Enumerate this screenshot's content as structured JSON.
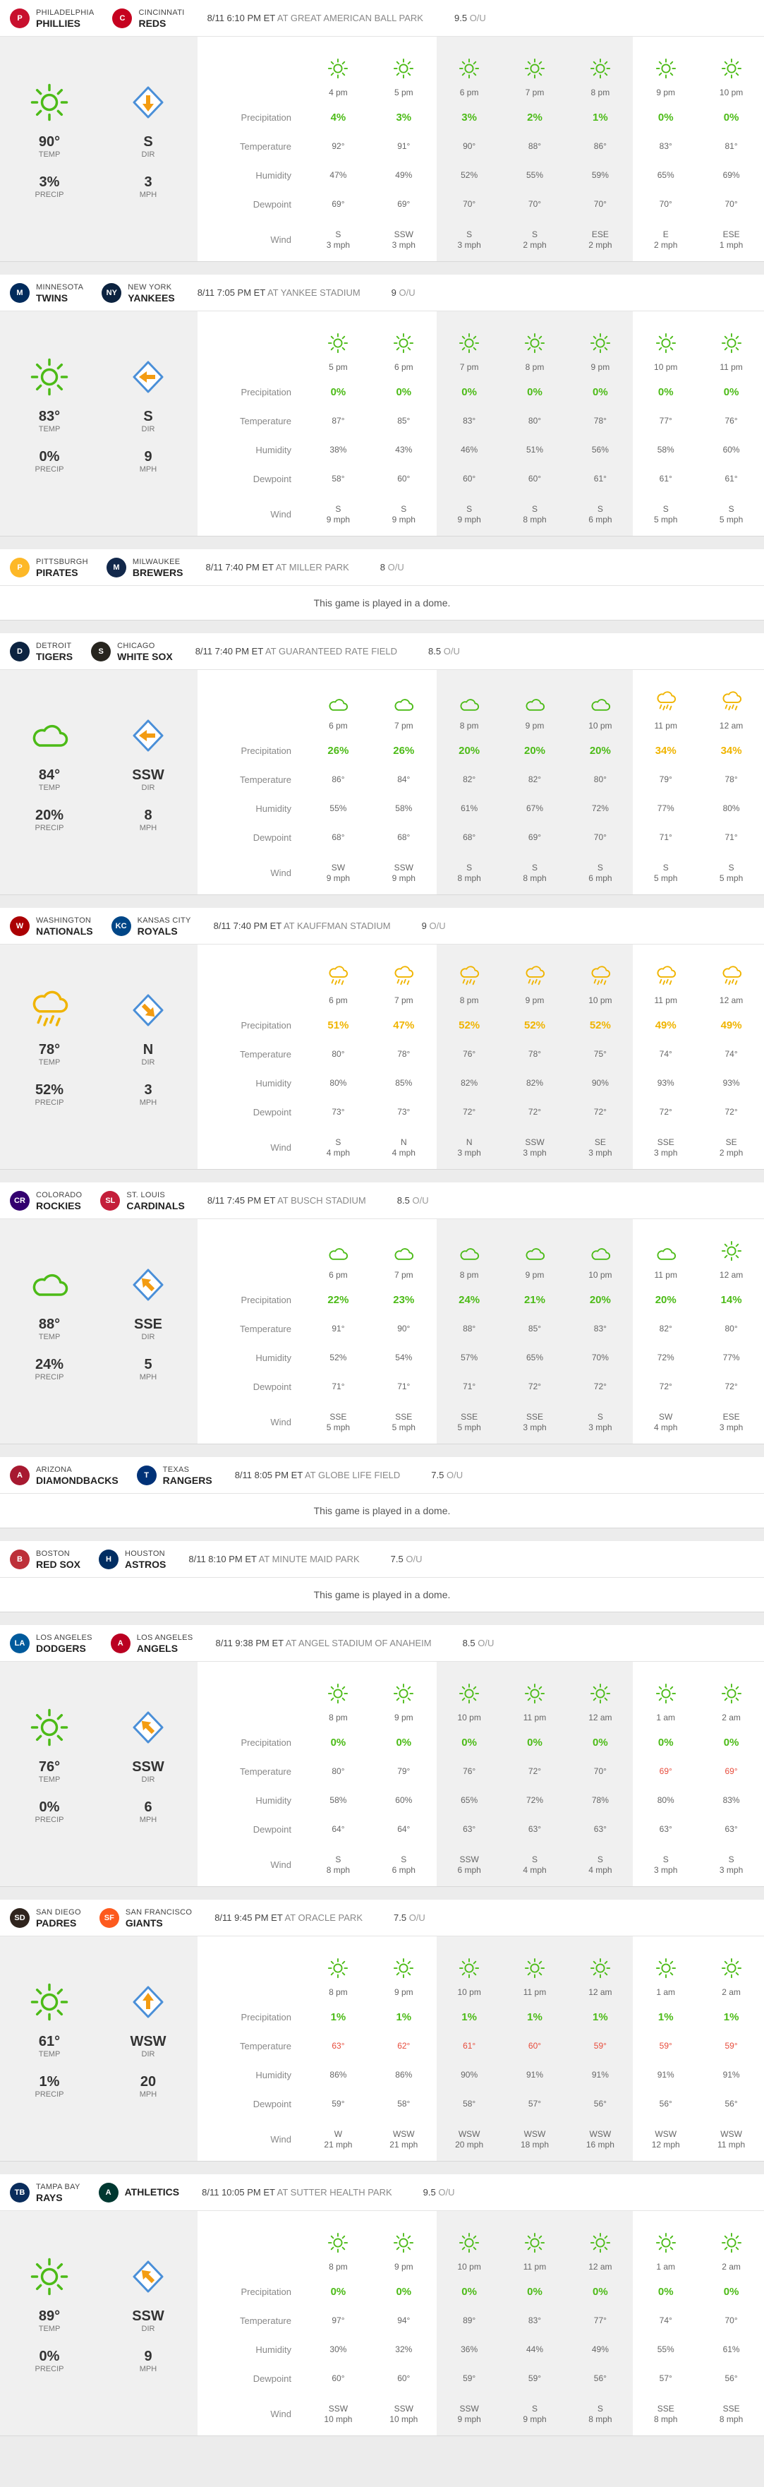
{
  "labels": {
    "precipitation": "Precipitation",
    "temperature": "Temperature",
    "humidity": "Humidity",
    "dewpoint": "Dewpoint",
    "wind": "Wind",
    "temp": "TEMP",
    "precip": "PRECIP",
    "dir": "DIR",
    "mph": "MPH",
    "ou": "O/U"
  },
  "colors": {
    "green": "#4cbb17",
    "yellow": "#f0b400",
    "red": "#e74c3c"
  },
  "games": [
    {
      "away": {
        "city": "Philadelphia",
        "nick": "Phillies",
        "abbr": "P",
        "color": "#c8102e"
      },
      "home": {
        "city": "Cincinnati",
        "nick": "Reds",
        "abbr": "C",
        "color": "#c6011f"
      },
      "time": "8/11 6:10 PM ET",
      "park": "at Great American Ball Park",
      "ou": "9.5",
      "dome": false,
      "summary": {
        "icon": "sun",
        "temp": "90°",
        "precip": "3%",
        "dir": "S",
        "mph": "3",
        "arrow": "S"
      },
      "hours": [
        {
          "t": "4 pm",
          "icon": "sun",
          "p": "4%",
          "temp": "92°",
          "hum": "47%",
          "dew": "69°",
          "wd": "S",
          "ws": "3 mph"
        },
        {
          "t": "5 pm",
          "icon": "sun",
          "p": "3%",
          "temp": "91°",
          "hum": "49%",
          "dew": "69°",
          "wd": "SSW",
          "ws": "3 mph"
        },
        {
          "t": "6 pm",
          "icon": "sun",
          "p": "3%",
          "temp": "90°",
          "hum": "52%",
          "dew": "70°",
          "wd": "S",
          "ws": "3 mph"
        },
        {
          "t": "7 pm",
          "icon": "sun",
          "p": "2%",
          "temp": "88°",
          "hum": "55%",
          "dew": "70°",
          "wd": "S",
          "ws": "2 mph"
        },
        {
          "t": "8 pm",
          "icon": "sun",
          "p": "1%",
          "temp": "86°",
          "hum": "59%",
          "dew": "70°",
          "wd": "ESE",
          "ws": "2 mph"
        },
        {
          "t": "9 pm",
          "icon": "sun",
          "p": "0%",
          "temp": "83°",
          "hum": "65%",
          "dew": "70°",
          "wd": "E",
          "ws": "2 mph"
        },
        {
          "t": "10 pm",
          "icon": "sun",
          "p": "0%",
          "temp": "81°",
          "hum": "69%",
          "dew": "70°",
          "wd": "ESE",
          "ws": "1 mph"
        }
      ]
    },
    {
      "away": {
        "city": "Minnesota",
        "nick": "Twins",
        "abbr": "M",
        "color": "#002b5c"
      },
      "home": {
        "city": "New York",
        "nick": "Yankees",
        "abbr": "NY",
        "color": "#0c2340"
      },
      "time": "8/11 7:05 PM ET",
      "park": "at Yankee Stadium",
      "ou": "9",
      "dome": false,
      "summary": {
        "icon": "sun",
        "temp": "83°",
        "precip": "0%",
        "dir": "S",
        "mph": "9",
        "arrow": "W"
      },
      "hours": [
        {
          "t": "5 pm",
          "icon": "sun",
          "p": "0%",
          "temp": "87°",
          "hum": "38%",
          "dew": "58°",
          "wd": "S",
          "ws": "9 mph"
        },
        {
          "t": "6 pm",
          "icon": "sun",
          "p": "0%",
          "temp": "85°",
          "hum": "43%",
          "dew": "60°",
          "wd": "S",
          "ws": "9 mph"
        },
        {
          "t": "7 pm",
          "icon": "sun",
          "p": "0%",
          "temp": "83°",
          "hum": "46%",
          "dew": "60°",
          "wd": "S",
          "ws": "9 mph"
        },
        {
          "t": "8 pm",
          "icon": "sun",
          "p": "0%",
          "temp": "80°",
          "hum": "51%",
          "dew": "60°",
          "wd": "S",
          "ws": "8 mph"
        },
        {
          "t": "9 pm",
          "icon": "sun",
          "p": "0%",
          "temp": "78°",
          "hum": "56%",
          "dew": "61°",
          "wd": "S",
          "ws": "6 mph"
        },
        {
          "t": "10 pm",
          "icon": "sun",
          "p": "0%",
          "temp": "77°",
          "hum": "58%",
          "dew": "61°",
          "wd": "S",
          "ws": "5 mph"
        },
        {
          "t": "11 pm",
          "icon": "sun",
          "p": "0%",
          "temp": "76°",
          "hum": "60%",
          "dew": "61°",
          "wd": "S",
          "ws": "5 mph"
        }
      ]
    },
    {
      "away": {
        "city": "Pittsburgh",
        "nick": "Pirates",
        "abbr": "P",
        "color": "#fdb827"
      },
      "home": {
        "city": "Milwaukee",
        "nick": "Brewers",
        "abbr": "M",
        "color": "#12284b"
      },
      "time": "8/11 7:40 PM ET",
      "park": "at Miller Park",
      "ou": "8",
      "dome": true,
      "domeText": "This game is played in a dome."
    },
    {
      "away": {
        "city": "Detroit",
        "nick": "Tigers",
        "abbr": "D",
        "color": "#0c2340"
      },
      "home": {
        "city": "Chicago",
        "nick": "White Sox",
        "abbr": "S",
        "color": "#27251f"
      },
      "time": "8/11 7:40 PM ET",
      "park": "at Guaranteed Rate Field",
      "ou": "8.5",
      "dome": false,
      "summary": {
        "icon": "cloud",
        "temp": "84°",
        "precip": "20%",
        "dir": "SSW",
        "mph": "8",
        "arrow": "W"
      },
      "hours": [
        {
          "t": "6 pm",
          "icon": "cloud",
          "p": "26%",
          "temp": "86°",
          "hum": "55%",
          "dew": "68°",
          "wd": "SW",
          "ws": "9 mph"
        },
        {
          "t": "7 pm",
          "icon": "cloud",
          "p": "26%",
          "temp": "84°",
          "hum": "58%",
          "dew": "68°",
          "wd": "SSW",
          "ws": "9 mph"
        },
        {
          "t": "8 pm",
          "icon": "cloud",
          "p": "20%",
          "temp": "82°",
          "hum": "61%",
          "dew": "68°",
          "wd": "S",
          "ws": "8 mph"
        },
        {
          "t": "9 pm",
          "icon": "cloud",
          "p": "20%",
          "temp": "82°",
          "hum": "67%",
          "dew": "69°",
          "wd": "S",
          "ws": "8 mph"
        },
        {
          "t": "10 pm",
          "icon": "cloud",
          "p": "20%",
          "temp": "80°",
          "hum": "72%",
          "dew": "70°",
          "wd": "S",
          "ws": "6 mph"
        },
        {
          "t": "11 pm",
          "icon": "rain",
          "p": "34%",
          "y": true,
          "temp": "79°",
          "hum": "77%",
          "dew": "71°",
          "wd": "S",
          "ws": "5 mph"
        },
        {
          "t": "12 am",
          "icon": "rain",
          "p": "34%",
          "y": true,
          "temp": "78°",
          "hum": "80%",
          "dew": "71°",
          "wd": "S",
          "ws": "5 mph"
        }
      ]
    },
    {
      "away": {
        "city": "Washington",
        "nick": "Nationals",
        "abbr": "W",
        "color": "#ab0003"
      },
      "home": {
        "city": "Kansas City",
        "nick": "Royals",
        "abbr": "KC",
        "color": "#004687"
      },
      "time": "8/11 7:40 PM ET",
      "park": "at Kauffman Stadium",
      "ou": "9",
      "dome": false,
      "summary": {
        "icon": "rain",
        "temp": "78°",
        "precip": "52%",
        "dir": "N",
        "mph": "3",
        "arrow": "SE"
      },
      "hours": [
        {
          "t": "6 pm",
          "icon": "rain",
          "p": "51%",
          "y": true,
          "temp": "80°",
          "hum": "80%",
          "dew": "73°",
          "wd": "S",
          "ws": "4 mph"
        },
        {
          "t": "7 pm",
          "icon": "rain",
          "p": "47%",
          "y": true,
          "temp": "78°",
          "hum": "85%",
          "dew": "73°",
          "wd": "N",
          "ws": "4 mph"
        },
        {
          "t": "8 pm",
          "icon": "rain",
          "p": "52%",
          "y": true,
          "temp": "76°",
          "hum": "82%",
          "dew": "72°",
          "wd": "N",
          "ws": "3 mph"
        },
        {
          "t": "9 pm",
          "icon": "rain",
          "p": "52%",
          "y": true,
          "temp": "78°",
          "hum": "82%",
          "dew": "72°",
          "wd": "SSW",
          "ws": "3 mph"
        },
        {
          "t": "10 pm",
          "icon": "rain",
          "p": "52%",
          "y": true,
          "temp": "75°",
          "hum": "90%",
          "dew": "72°",
          "wd": "SE",
          "ws": "3 mph"
        },
        {
          "t": "11 pm",
          "icon": "rain",
          "p": "49%",
          "y": true,
          "temp": "74°",
          "hum": "93%",
          "dew": "72°",
          "wd": "SSE",
          "ws": "3 mph"
        },
        {
          "t": "12 am",
          "icon": "rain",
          "p": "49%",
          "y": true,
          "temp": "74°",
          "hum": "93%",
          "dew": "72°",
          "wd": "SE",
          "ws": "2 mph"
        }
      ]
    },
    {
      "away": {
        "city": "Colorado",
        "nick": "Rockies",
        "abbr": "CR",
        "color": "#33006f"
      },
      "home": {
        "city": "St. Louis",
        "nick": "Cardinals",
        "abbr": "SL",
        "color": "#c41e3a"
      },
      "time": "8/11 7:45 PM ET",
      "park": "at Busch Stadium",
      "ou": "8.5",
      "dome": false,
      "summary": {
        "icon": "cloud",
        "temp": "88°",
        "precip": "24%",
        "dir": "SSE",
        "mph": "5",
        "arrow": "NW"
      },
      "hours": [
        {
          "t": "6 pm",
          "icon": "cloud",
          "p": "22%",
          "temp": "91°",
          "hum": "52%",
          "dew": "71°",
          "wd": "SSE",
          "ws": "5 mph"
        },
        {
          "t": "7 pm",
          "icon": "cloud",
          "p": "23%",
          "temp": "90°",
          "hum": "54%",
          "dew": "71°",
          "wd": "SSE",
          "ws": "5 mph"
        },
        {
          "t": "8 pm",
          "icon": "cloud",
          "p": "24%",
          "temp": "88°",
          "hum": "57%",
          "dew": "71°",
          "wd": "SSE",
          "ws": "5 mph"
        },
        {
          "t": "9 pm",
          "icon": "cloud",
          "p": "21%",
          "temp": "85°",
          "hum": "65%",
          "dew": "72°",
          "wd": "SSE",
          "ws": "3 mph"
        },
        {
          "t": "10 pm",
          "icon": "cloud",
          "p": "20%",
          "temp": "83°",
          "hum": "70%",
          "dew": "72°",
          "wd": "S",
          "ws": "3 mph"
        },
        {
          "t": "11 pm",
          "icon": "cloud",
          "p": "20%",
          "temp": "82°",
          "hum": "72%",
          "dew": "72°",
          "wd": "SW",
          "ws": "4 mph"
        },
        {
          "t": "12 am",
          "icon": "sun",
          "p": "14%",
          "temp": "80°",
          "hum": "77%",
          "dew": "72°",
          "wd": "ESE",
          "ws": "3 mph"
        }
      ]
    },
    {
      "away": {
        "city": "Arizona",
        "nick": "Diamondbacks",
        "abbr": "A",
        "color": "#a71930"
      },
      "home": {
        "city": "Texas",
        "nick": "Rangers",
        "abbr": "T",
        "color": "#003278"
      },
      "time": "8/11 8:05 PM ET",
      "park": "at Globe Life Field",
      "ou": "7.5",
      "dome": true,
      "domeText": "This game is played in a dome."
    },
    {
      "away": {
        "city": "Boston",
        "nick": "Red Sox",
        "abbr": "B",
        "color": "#bd3039"
      },
      "home": {
        "city": "Houston",
        "nick": "Astros",
        "abbr": "H",
        "color": "#002d62"
      },
      "time": "8/11 8:10 PM ET",
      "park": "at Minute Maid Park",
      "ou": "7.5",
      "dome": true,
      "domeText": "This game is played in a dome."
    },
    {
      "away": {
        "city": "Los Angeles",
        "nick": "Dodgers",
        "abbr": "LA",
        "color": "#005a9c"
      },
      "home": {
        "city": "Los Angeles",
        "nick": "Angels",
        "abbr": "A",
        "color": "#ba0021"
      },
      "time": "8/11 9:38 PM ET",
      "park": "at Angel Stadium of Anaheim",
      "ou": "8.5",
      "dome": false,
      "summary": {
        "icon": "sun",
        "temp": "76°",
        "precip": "0%",
        "dir": "SSW",
        "mph": "6",
        "arrow": "NW"
      },
      "hours": [
        {
          "t": "8 pm",
          "icon": "sun",
          "p": "0%",
          "temp": "80°",
          "hum": "58%",
          "dew": "64°",
          "wd": "S",
          "ws": "8 mph"
        },
        {
          "t": "9 pm",
          "icon": "sun",
          "p": "0%",
          "temp": "79°",
          "hum": "60%",
          "dew": "64°",
          "wd": "S",
          "ws": "6 mph"
        },
        {
          "t": "10 pm",
          "icon": "sun",
          "p": "0%",
          "temp": "76°",
          "hum": "65%",
          "dew": "63°",
          "wd": "SSW",
          "ws": "6 mph"
        },
        {
          "t": "11 pm",
          "icon": "sun",
          "p": "0%",
          "temp": "72°",
          "hum": "72%",
          "dew": "63°",
          "wd": "S",
          "ws": "4 mph"
        },
        {
          "t": "12 am",
          "icon": "sun",
          "p": "0%",
          "temp": "70°",
          "hum": "78%",
          "dew": "63°",
          "wd": "S",
          "ws": "4 mph"
        },
        {
          "t": "1 am",
          "icon": "sun",
          "p": "0%",
          "temp": "69°",
          "red": true,
          "hum": "80%",
          "dew": "63°",
          "wd": "S",
          "ws": "3 mph"
        },
        {
          "t": "2 am",
          "icon": "sun",
          "p": "0%",
          "temp": "69°",
          "red": true,
          "hum": "83%",
          "dew": "63°",
          "wd": "S",
          "ws": "3 mph"
        }
      ]
    },
    {
      "away": {
        "city": "San Diego",
        "nick": "Padres",
        "abbr": "SD",
        "color": "#2f241d"
      },
      "home": {
        "city": "San Francisco",
        "nick": "Giants",
        "abbr": "SF",
        "color": "#fd5a1e"
      },
      "time": "8/11 9:45 PM ET",
      "park": "at Oracle Park",
      "ou": "7.5",
      "dome": false,
      "summary": {
        "icon": "sun",
        "temp": "61°",
        "precip": "1%",
        "dir": "WSW",
        "mph": "20",
        "arrow": "N"
      },
      "hours": [
        {
          "t": "8 pm",
          "icon": "sun",
          "p": "1%",
          "temp": "63°",
          "red": true,
          "hum": "86%",
          "dew": "59°",
          "wd": "W",
          "ws": "21 mph"
        },
        {
          "t": "9 pm",
          "icon": "sun",
          "p": "1%",
          "temp": "62°",
          "red": true,
          "hum": "86%",
          "dew": "58°",
          "wd": "WSW",
          "ws": "21 mph"
        },
        {
          "t": "10 pm",
          "icon": "sun",
          "p": "1%",
          "temp": "61°",
          "red": true,
          "hum": "90%",
          "dew": "58°",
          "wd": "WSW",
          "ws": "20 mph"
        },
        {
          "t": "11 pm",
          "icon": "sun",
          "p": "1%",
          "temp": "60°",
          "red": true,
          "hum": "91%",
          "dew": "57°",
          "wd": "WSW",
          "ws": "18 mph"
        },
        {
          "t": "12 am",
          "icon": "sun",
          "p": "1%",
          "temp": "59°",
          "red": true,
          "hum": "91%",
          "dew": "56°",
          "wd": "WSW",
          "ws": "16 mph"
        },
        {
          "t": "1 am",
          "icon": "sun",
          "p": "1%",
          "temp": "59°",
          "red": true,
          "hum": "91%",
          "dew": "56°",
          "wd": "WSW",
          "ws": "12 mph"
        },
        {
          "t": "2 am",
          "icon": "sun",
          "p": "1%",
          "temp": "59°",
          "red": true,
          "hum": "91%",
          "dew": "56°",
          "wd": "WSW",
          "ws": "11 mph"
        }
      ]
    },
    {
      "away": {
        "city": "Tampa Bay",
        "nick": "Rays",
        "abbr": "TB",
        "color": "#092c5c"
      },
      "home": {
        "city": "",
        "nick": "Athletics",
        "abbr": "A",
        "color": "#003831"
      },
      "time": "8/11 10:05 PM ET",
      "park": "at Sutter Health Park",
      "ou": "9.5",
      "dome": false,
      "summary": {
        "icon": "sun",
        "temp": "89°",
        "precip": "0%",
        "dir": "SSW",
        "mph": "9",
        "arrow": "NW"
      },
      "hours": [
        {
          "t": "8 pm",
          "icon": "sun",
          "p": "0%",
          "temp": "97°",
          "hum": "30%",
          "dew": "60°",
          "wd": "SSW",
          "ws": "10 mph"
        },
        {
          "t": "9 pm",
          "icon": "sun",
          "p": "0%",
          "temp": "94°",
          "hum": "32%",
          "dew": "60°",
          "wd": "SSW",
          "ws": "10 mph"
        },
        {
          "t": "10 pm",
          "icon": "sun",
          "p": "0%",
          "temp": "89°",
          "hum": "36%",
          "dew": "59°",
          "wd": "SSW",
          "ws": "9 mph"
        },
        {
          "t": "11 pm",
          "icon": "sun",
          "p": "0%",
          "temp": "83°",
          "hum": "44%",
          "dew": "59°",
          "wd": "S",
          "ws": "9 mph"
        },
        {
          "t": "12 am",
          "icon": "sun",
          "p": "0%",
          "temp": "77°",
          "hum": "49%",
          "dew": "56°",
          "wd": "S",
          "ws": "8 mph"
        },
        {
          "t": "1 am",
          "icon": "sun",
          "p": "0%",
          "temp": "74°",
          "hum": "55%",
          "dew": "57°",
          "wd": "SSE",
          "ws": "8 mph"
        },
        {
          "t": "2 am",
          "icon": "sun",
          "p": "0%",
          "temp": "70°",
          "hum": "61%",
          "dew": "56°",
          "wd": "SSE",
          "ws": "8 mph"
        }
      ]
    }
  ]
}
